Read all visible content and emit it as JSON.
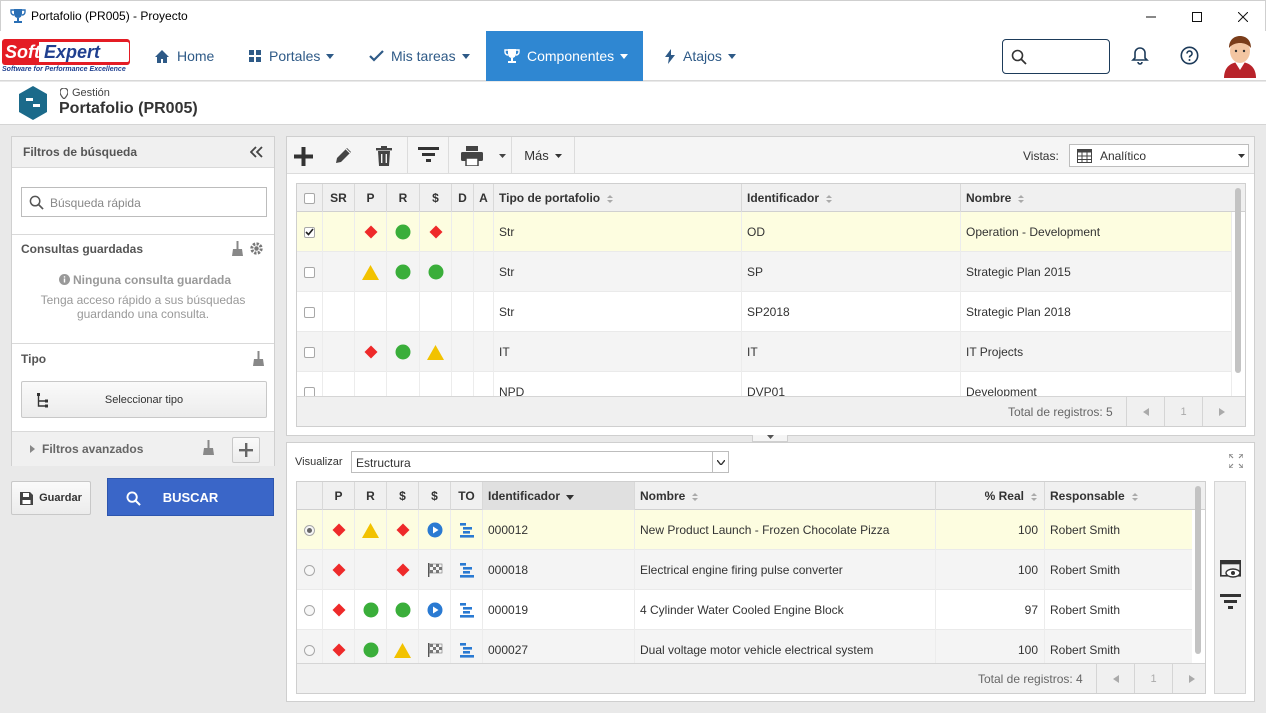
{
  "window": {
    "title": "Portafolio (PR005) - Proyecto"
  },
  "brand": {
    "logo_text_a": "Soft",
    "logo_text_b": "Expert",
    "tagline": "Software for Performance Excellence"
  },
  "nav": {
    "items": [
      {
        "label": "Home",
        "icon": "home-icon"
      },
      {
        "label": "Portales",
        "icon": "grid-icon"
      },
      {
        "label": "Mis tareas",
        "icon": "check-icon"
      },
      {
        "label": "Componentes",
        "icon": "trophy-icon",
        "active": true
      },
      {
        "label": "Atajos",
        "icon": "bolt-icon"
      }
    ],
    "search_placeholder": ""
  },
  "header": {
    "breadcrumb": "Gestión",
    "title": "Portafolio (PR005)"
  },
  "left": {
    "filters_title": "Filtros de búsqueda",
    "quick_search_placeholder": "Búsqueda rápida",
    "saved_title": "Consultas guardadas",
    "saved_empty": "Ninguna consulta guardada",
    "saved_hint": "Tenga acceso rápido a sus búsquedas guardando una consulta.",
    "type_title": "Tipo",
    "select_type": "Seleccionar tipo",
    "advanced": "Filtros avanzados",
    "save_btn": "Guardar",
    "search_btn": "BUSCAR"
  },
  "toolbar": {
    "more": "Más",
    "views_label": "Vistas:",
    "view_selected": "Analítico"
  },
  "top_grid": {
    "columns": [
      "SR",
      "P",
      "R",
      "$",
      "D",
      "A",
      "Tipo de portafolio",
      "Identificador",
      "Nombre"
    ],
    "rows": [
      {
        "checked": true,
        "p": "red-diamond",
        "r": "green-circle",
        "s": "red-diamond",
        "tipo": "Str",
        "id": "OD",
        "nombre": "Operation - Development"
      },
      {
        "checked": false,
        "p": "yellow-triangle",
        "r": "green-circle",
        "s": "green-circle",
        "tipo": "Str",
        "id": "SP",
        "nombre": "Strategic Plan 2015"
      },
      {
        "checked": false,
        "p": "",
        "r": "",
        "s": "",
        "tipo": "Str",
        "id": "SP2018",
        "nombre": "Strategic Plan 2018"
      },
      {
        "checked": false,
        "p": "red-diamond",
        "r": "green-circle",
        "s": "yellow-triangle",
        "tipo": "IT",
        "id": "IT",
        "nombre": "IT Projects"
      },
      {
        "checked": false,
        "p": "",
        "r": "",
        "s": "",
        "tipo": "NPD",
        "id": "DVP01",
        "nombre": "Development"
      }
    ],
    "total": "Total de registros: 5",
    "page": "1"
  },
  "bottom": {
    "visualizar_label": "Visualizar",
    "visualizar_value": "Estructura",
    "columns": [
      "P",
      "R",
      "$",
      "$",
      "TO",
      "Identificador",
      "Nombre",
      "% Real",
      "Responsable"
    ],
    "rows": [
      {
        "p": "red-diamond",
        "r": "yellow-triangle",
        "s1": "red-diamond",
        "s2": "play-icon",
        "id": "000012",
        "nombre": "New Product Launch - Frozen Chocolate Pizza",
        "real": "100",
        "resp": "Robert Smith"
      },
      {
        "p": "red-diamond",
        "r": "",
        "s1": "red-diamond",
        "s2": "flag-icon",
        "id": "000018",
        "nombre": "Electrical engine firing pulse converter",
        "real": "100",
        "resp": "Robert Smith"
      },
      {
        "p": "red-diamond",
        "r": "green-circle",
        "s1": "green-circle",
        "s2": "play-icon",
        "id": "000019",
        "nombre": "4 Cylinder Water Cooled Engine Block",
        "real": "97",
        "resp": "Robert Smith"
      },
      {
        "p": "red-diamond",
        "r": "green-circle",
        "s1": "yellow-triangle",
        "s2": "flag-icon",
        "id": "000027",
        "nombre": "Dual voltage motor vehicle electrical system",
        "real": "100",
        "resp": "Robert Smith"
      }
    ],
    "total": "Total de registros: 4",
    "page": "1"
  },
  "colors": {
    "accent": "#2f87d2",
    "nav_text": "#2e5a87",
    "search_btn": "#3a66c8",
    "row_selected": "#fdfde0",
    "red": "#ee2a2a",
    "green": "#3aae3a",
    "yellow": "#f2c200",
    "blue": "#2a7ad2"
  }
}
